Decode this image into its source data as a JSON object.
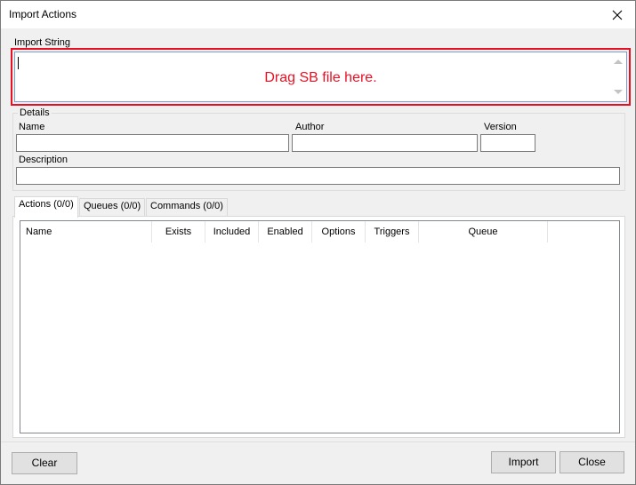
{
  "window": {
    "title": "Import Actions",
    "close_symbol": "✕"
  },
  "import_string": {
    "label": "Import String",
    "value": "",
    "drop_hint": "Drag SB file here.",
    "highlight_color": "#e81123"
  },
  "details": {
    "legend": "Details",
    "name_label": "Name",
    "name_value": "",
    "author_label": "Author",
    "author_value": "",
    "version_label": "Version",
    "version_value": "",
    "description_label": "Description",
    "description_value": ""
  },
  "tabs": [
    {
      "label": "Actions (0/0)",
      "active": true
    },
    {
      "label": "Queues (0/0)",
      "active": false
    },
    {
      "label": "Commands (0/0)",
      "active": false
    }
  ],
  "actions_list": {
    "columns": [
      "Name",
      "Exists",
      "Included",
      "Enabled",
      "Options",
      "Triggers",
      "Queue"
    ],
    "rows": []
  },
  "buttons": {
    "clear": "Clear",
    "import": "Import",
    "close": "Close"
  }
}
